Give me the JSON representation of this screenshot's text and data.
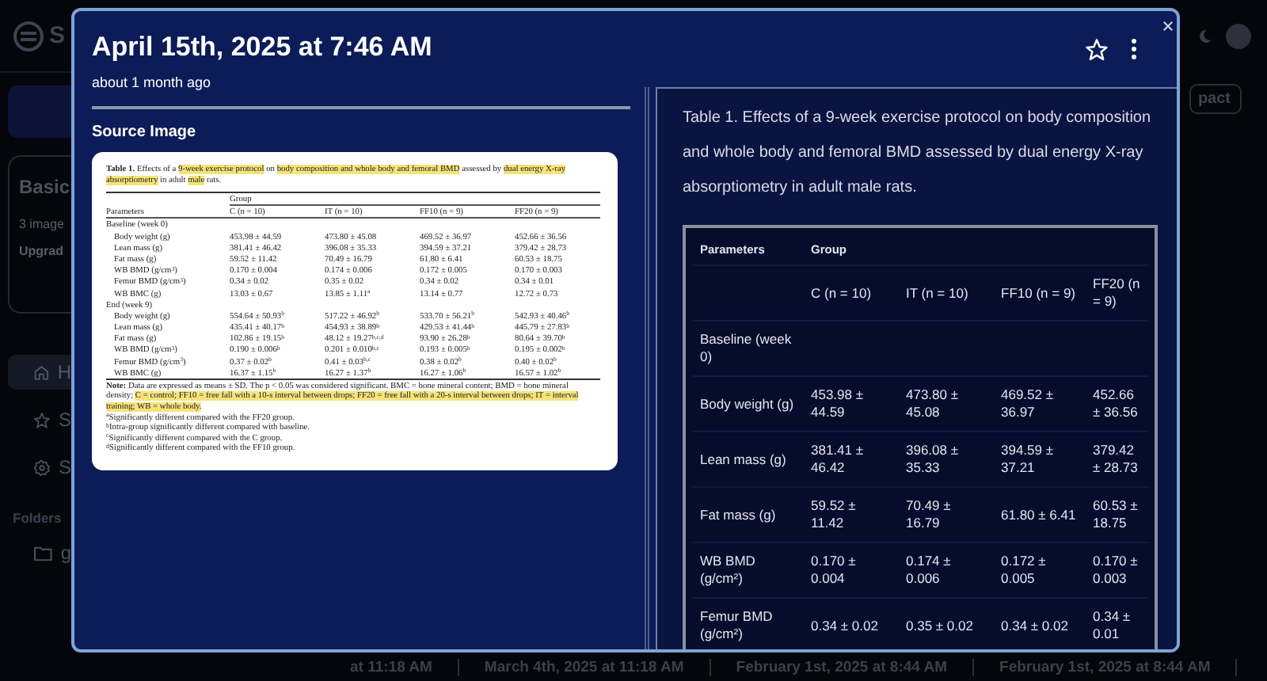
{
  "sidebar": {
    "brand": "S",
    "card": {
      "title": "Basic",
      "subtitle": "3 image",
      "action": "Upgrad"
    },
    "nav_items": [
      {
        "label": "H",
        "kind": "home",
        "selected": true
      },
      {
        "label": "S",
        "kind": "star",
        "selected": false
      },
      {
        "label": "S",
        "kind": "gear",
        "selected": false
      }
    ],
    "folders_heading": "Folders",
    "folders": [
      {
        "label": "g"
      }
    ]
  },
  "header_right": {
    "button": "pact"
  },
  "modal": {
    "title": "April 15th, 2025 at 7:46 AM",
    "subtitle": "about 1 month ago",
    "starred": false,
    "source_heading": "Source Image",
    "source_table": {
      "caption": {
        "label": "Table 1.",
        "segments": [
          {
            "text": "Effects of a ",
            "highlight": false
          },
          {
            "text": "9-week exercise protocol",
            "highlight": true
          },
          {
            "text": " on ",
            "highlight": false
          },
          {
            "text": "body composition and whole body and femoral BMD",
            "highlight": true
          },
          {
            "text": " assessed by ",
            "highlight": false
          },
          {
            "text": "dual energy X-ray absorptiometry",
            "highlight": true
          },
          {
            "text": " in adult ",
            "highlight": false
          },
          {
            "text": "male",
            "highlight": true
          },
          {
            "text": " rats.",
            "highlight": false
          }
        ]
      },
      "group_label": "Group",
      "param_label": "Parameters",
      "columns": [
        "C (n = 10)",
        "IT (n = 10)",
        "FF10 (n = 9)",
        "FF20 (n = 9)"
      ],
      "rows": [
        {
          "kind": "section",
          "label": "Baseline (week 0)"
        },
        {
          "kind": "data",
          "label": "Body weight (g)",
          "values": [
            "453.98 ± 44.59",
            "473.80 ± 45.08",
            "469.52 ± 36.97",
            "452.66 ± 36.56"
          ]
        },
        {
          "kind": "data",
          "label": "Lean mass (g)",
          "values": [
            "381.41 ± 46.42",
            "396.08 ± 35.33",
            "394.59 ± 37.21",
            "379.42 ± 28.73"
          ]
        },
        {
          "kind": "data",
          "label": "Fat mass (g)",
          "values": [
            "59.52 ± 11.42",
            "70.49 ± 16.79",
            "61.80 ± 6.41",
            "60.53 ± 18.75"
          ]
        },
        {
          "kind": "data",
          "label": "WB BMD (g/cm$^{3}$)",
          "values": [
            "0.170 ± 0.004",
            "0.174 ± 0.006",
            "0.172 ± 0.005",
            "0.170 ± 0.003"
          ]
        },
        {
          "kind": "data",
          "label": "Femur BMD (g/cm$^{3}$)",
          "values": [
            "0.34 ± 0.02",
            "0.35 ± 0.02",
            "0.34 ± 0.02",
            "0.34 ± 0.01"
          ]
        },
        {
          "kind": "data",
          "label": "WB BMC (g)",
          "values": [
            "13.03 ± 0.67",
            "13.85 ± 1.11$^{a}$",
            "13.14 ± 0.77",
            "12.72 ± 0.73"
          ]
        },
        {
          "kind": "section",
          "label": "End (week 9)"
        },
        {
          "kind": "data",
          "label": "Body weight (g)",
          "values": [
            "554.64 ± 50.93$^{b}$",
            "517.22 ± 46.92$^{b}$",
            "533.70 ± 56.21$^{b}$",
            "542.93 ± 40.46$^{b}$"
          ]
        },
        {
          "kind": "data",
          "label": "Lean mass (g)",
          "values": [
            "435.41 ± 40.17$^{b}$",
            "454.93 ± 38.89$^{b}$",
            "429.53 ± 41.44$^{b}$",
            "445.79 ± 27.83$^{b}$"
          ]
        },
        {
          "kind": "data",
          "label": "Fat mass (g)",
          "values": [
            "102.86 ± 19.15$^{b}$",
            "48.12 ± 19.27$^{b,c,d}$",
            "93.90 ± 26.28$^{b}$",
            "80.64 ± 39.70$^{b}$"
          ]
        },
        {
          "kind": "data",
          "label": "WB BMD (g/cm$^{3}$)",
          "values": [
            "0.190 ± 0.006$^{b}$",
            "0.201 ± 0.010$^{b,c}$",
            "0.193 ± 0.005$^{b}$",
            "0.195 ± 0.002$^{b}$"
          ]
        },
        {
          "kind": "data",
          "label": "Femur BMD (g/cm$^{3}$)",
          "values": [
            "0.37 ± 0.02$^{b}$",
            "0.41 ± 0.03$^{b,c}$",
            "0.38 ± 0.02$^{b}$",
            "0.40 ± 0.02$^{b}$"
          ]
        },
        {
          "kind": "data",
          "label": "WB BMC (g)",
          "values": [
            "16.37 ± 1.15$^{b}$",
            "16.27 ± 1.37$^{b}$",
            "16.27 ± 1.06$^{b}$",
            "16.57 ± 1.02$^{b}$"
          ]
        }
      ],
      "note": {
        "label": "Note:",
        "segments": [
          {
            "text": "Data are expressed as means ± SD. The p < 0.05 was considered significant. BMC = bone mineral content; BMD = bone mineral density; ",
            "highlight": false
          },
          {
            "text": "C = control; FF10 = free fall with a 10-s interval between drops; FF20 = free fall with a 20-s interval between drops; IT = interval training; WB = whole body.",
            "highlight": true
          }
        ]
      },
      "footnotes": [
        "$^{a}$Significantly different compared with the FF20 group.",
        "$^{b}$Intra-group significantly different compared with baseline.",
        "$^{c}$Significantly different compared with the C group.",
        "$^{d}$Significantly different compared with the FF10 group."
      ]
    },
    "parsed": {
      "caption": "Table 1. Effects of a 9-week exercise protocol on body composition and whole body and femoral BMD assessed by dual energy X-ray absorptiometry in adult male rats.",
      "param_label": "Parameters",
      "group_label": "Group",
      "columns": [
        "C (n = 10)",
        "IT (n = 10)",
        "FF10 (n = 9)",
        "FF20 (n = 9)"
      ],
      "rows": [
        {
          "kind": "section",
          "label": "Baseline (week 0)"
        },
        {
          "kind": "data",
          "label": "Body weight (g)",
          "values": [
            "453.98 ± 44.59",
            "473.80 ± 45.08",
            "469.52 ± 36.97",
            "452.66 ± 36.56"
          ]
        },
        {
          "kind": "data",
          "label": "Lean mass (g)",
          "values": [
            "381.41 ± 46.42",
            "396.08 ± 35.33",
            "394.59 ± 37.21",
            "379.42 ± 28.73"
          ]
        },
        {
          "kind": "data",
          "label": "Fat mass (g)",
          "values": [
            "59.52 ± 11.42",
            "70.49 ± 16.79",
            "61.80 ± 6.41",
            "60.53 ± 18.75"
          ]
        },
        {
          "kind": "data",
          "label": "WB BMD (g/cm²)",
          "values": [
            "0.170 ± 0.004",
            "0.174 ± 0.006",
            "0.172 ± 0.005",
            "0.170 ± 0.003"
          ]
        },
        {
          "kind": "data",
          "label": "Femur BMD (g/cm²)",
          "values": [
            "0.34 ± 0.02",
            "0.35 ± 0.02",
            "0.34 ± 0.02",
            "0.34 ± 0.01"
          ]
        }
      ]
    }
  },
  "history_row": [
    "at 11:18 AM",
    "March 4th, 2025 at 11:18 AM",
    "February 1st, 2025 at 8:44 AM",
    "February 1st, 2025 at 8:44 AM"
  ]
}
